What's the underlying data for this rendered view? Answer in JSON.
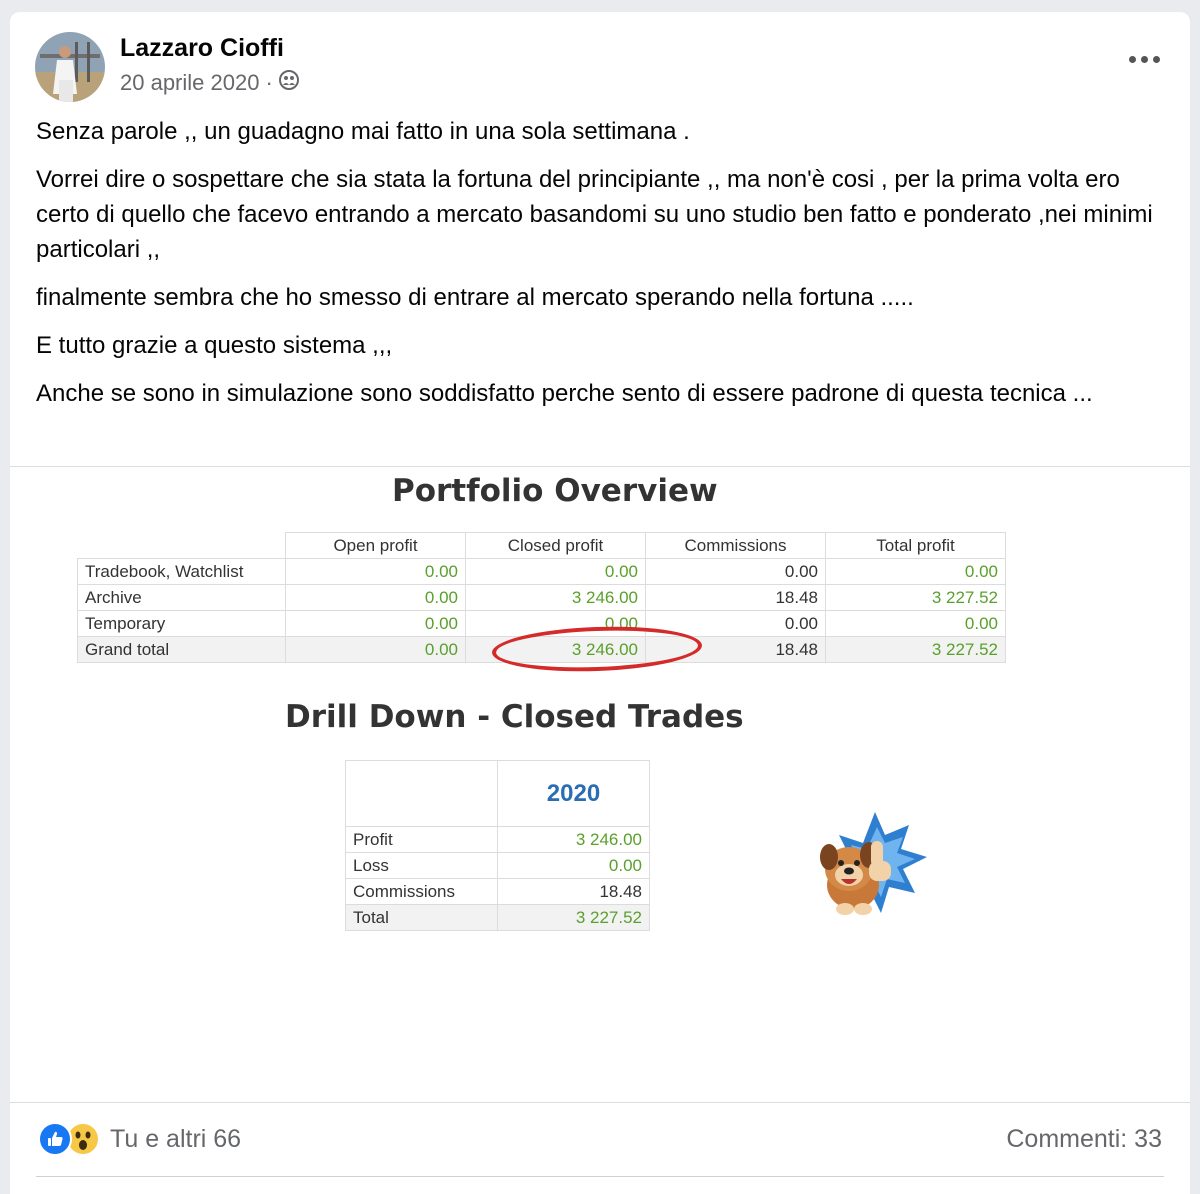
{
  "post": {
    "author": "Lazzaro Cioffi",
    "date": "20 aprile 2020 ·",
    "privacy_icon": "friends-icon",
    "paragraphs": [
      "Senza parole ,, un guadagno mai fatto  in una sola settimana .",
      "Vorrei dire o sospettare che sia stata la fortuna del principiante ,, ma non'è cosi , per la prima volta ero certo di quello che facevo entrando a mercato basandomi  su uno studio ben fatto e ponderato ,nei minimi particolari ,,",
      "finalmente sembra che ho smesso di entrare al mercato sperando nella fortuna .....",
      "E tutto grazie a questo sistema ,,,",
      "Anche se sono in simulazione sono soddisfatto perche sento di essere padrone di questa tecnica ..."
    ]
  },
  "image": {
    "portfolio_title": "Portfolio Overview",
    "portfolio_headers": [
      "Open profit",
      "Closed profit",
      "Commissions",
      "Total profit"
    ],
    "portfolio_rows": [
      {
        "label": "Tradebook, Watchlist",
        "open": "0.00",
        "closed": "0.00",
        "commissions": "0.00",
        "total": "0.00"
      },
      {
        "label": "Archive",
        "open": "0.00",
        "closed": "3 246.00",
        "commissions": "18.48",
        "total": "3 227.52"
      },
      {
        "label": "Temporary",
        "open": "0.00",
        "closed": "0.00",
        "commissions": "0.00",
        "total": "0.00"
      },
      {
        "label": "Grand total",
        "open": "0.00",
        "closed": "3 246.00",
        "commissions": "18.48",
        "total": "3 227.52"
      }
    ],
    "drilldown_title": "Drill Down - Closed Trades",
    "drilldown_year": "2020",
    "drilldown_rows": [
      {
        "label": "Profit",
        "value": "3 246.00"
      },
      {
        "label": "Loss",
        "value": "0.00"
      },
      {
        "label": "Commissions",
        "value": "18.48"
      },
      {
        "label": "Total",
        "value": "3 227.52"
      }
    ],
    "highlight_color": "#d42a2a",
    "positive_color": "#5aa02c"
  },
  "footer": {
    "reaction_icons": [
      "like-icon",
      "wow-icon"
    ],
    "reactions_text": "Tu e altri 66",
    "comments_text": "Commenti: 33"
  }
}
